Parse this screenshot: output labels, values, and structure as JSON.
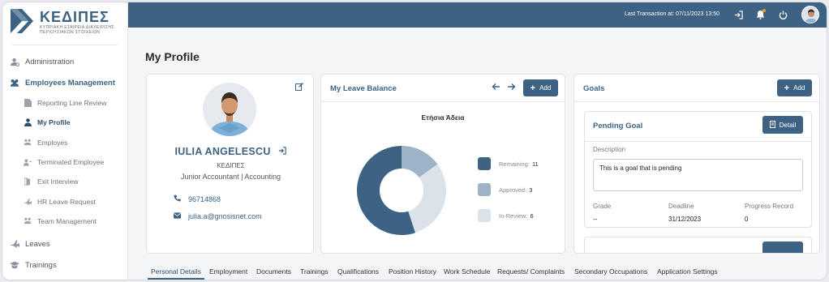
{
  "brand": {
    "title": "ΚΕΔΙΠΕΣ",
    "subtitle_line1": "ΚΥΠΡΙΑΚΗ ΕΤΑΙΡΕΙΑ ΔΙΑΧΕΙΡΙΣΗΣ",
    "subtitle_line2": "ΠΕΡΙΟΥΣΙΑΚΩΝ ΣΤΟΙΧΕΙΩΝ"
  },
  "sidebar": {
    "items": [
      {
        "label": "Administration",
        "icon": "user-gear-icon"
      },
      {
        "label": "Employees Management",
        "icon": "users-icon"
      },
      {
        "label": "Leaves",
        "icon": "plane-icon"
      },
      {
        "label": "Trainings",
        "icon": "graduation-cap-icon"
      }
    ],
    "sub_items": [
      {
        "label": "Reporting Line Review",
        "icon": "file-icon"
      },
      {
        "label": "My Profile",
        "icon": "user-icon"
      },
      {
        "label": "Employes",
        "icon": "users-icon"
      },
      {
        "label": "Terminated Employee",
        "icon": "user-minus-icon"
      },
      {
        "label": "Exit Interview",
        "icon": "door-exit-icon"
      },
      {
        "label": "HR Leave Request",
        "icon": "plane-icon"
      },
      {
        "label": "Team Management",
        "icon": "team-icon"
      }
    ]
  },
  "topbar": {
    "last_transaction": "Last Transaction at: 07/11/2023 13:50",
    "icons": [
      "sign-in-icon",
      "bell-icon",
      "power-icon",
      "avatar"
    ]
  },
  "page": {
    "title": "My Profile"
  },
  "profile": {
    "name": "IULIA ANGELESCU",
    "company": "ΚΕΔΙΠΕΣ",
    "role": "Junior Accountant | Accounting",
    "phone": "96714868",
    "email": "julia.a@gnosisnet.com"
  },
  "leave_balance": {
    "title": "My Leave Balance",
    "add_label": "Add",
    "chart_data": {
      "type": "pie",
      "title": "Ετήσια Άδεια",
      "categories": [
        "Remaining",
        "Approved",
        "In-Review"
      ],
      "values": [
        11,
        3,
        6
      ],
      "colors": [
        "#3d6283",
        "#9fb3c6",
        "#dbe3ea"
      ]
    },
    "legend": [
      {
        "label": "Remaining:",
        "value": "11",
        "color": "#3d6283"
      },
      {
        "label": "Approved:",
        "value": "3",
        "color": "#9fb3c6"
      },
      {
        "label": "In-Review:",
        "value": "6",
        "color": "#dbe3ea"
      }
    ]
  },
  "goals": {
    "title": "Goals",
    "add_label": "Add",
    "goal": {
      "title": "Pending Goal",
      "detail_label": "Detail",
      "description_label": "Description",
      "description": "This is a goal that is pending",
      "grade_label": "Grade",
      "grade": "--",
      "deadline_label": "Deadline",
      "deadline": "31/12/2023",
      "progress_label": "Progress Record",
      "progress": "0"
    }
  },
  "tabs": [
    "Personal Details",
    "Employment",
    "Documents",
    "Trainings",
    "Qualifications",
    "Position History",
    "Work Schedule",
    "Requests/ Complaints",
    "Secondary Occupations",
    "Application Settings"
  ],
  "colors": {
    "primary": "#3d6283",
    "background": "#f4f5f7"
  }
}
